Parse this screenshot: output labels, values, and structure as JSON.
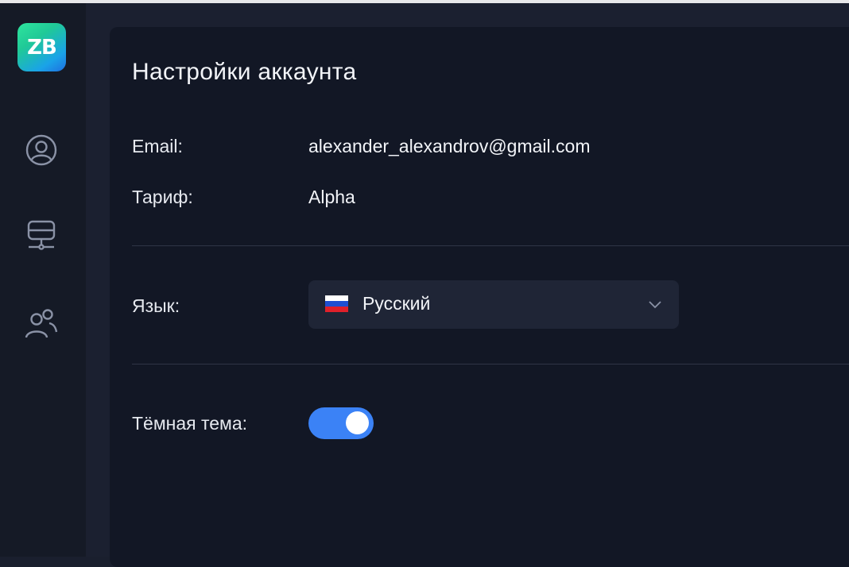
{
  "app": {
    "logo_text": "ZB"
  },
  "sidebar": {
    "items": [
      {
        "icon": "user-circle-icon"
      },
      {
        "icon": "server-network-icon"
      },
      {
        "icon": "users-icon"
      }
    ]
  },
  "settings": {
    "title": "Настройки аккаунта",
    "email_label": "Email:",
    "email_value": "alexander_alexandrov@gmail.com",
    "plan_label": "Тариф:",
    "plan_value": "Alpha",
    "language_label": "Язык:",
    "language_value": "Русский",
    "language_flag": "ru-flag-icon",
    "dark_theme_label": "Тёмная тема:",
    "dark_theme_enabled": true
  },
  "colors": {
    "accent": "#3b82f6",
    "background": "#121725",
    "sidebar": "#151a26"
  }
}
